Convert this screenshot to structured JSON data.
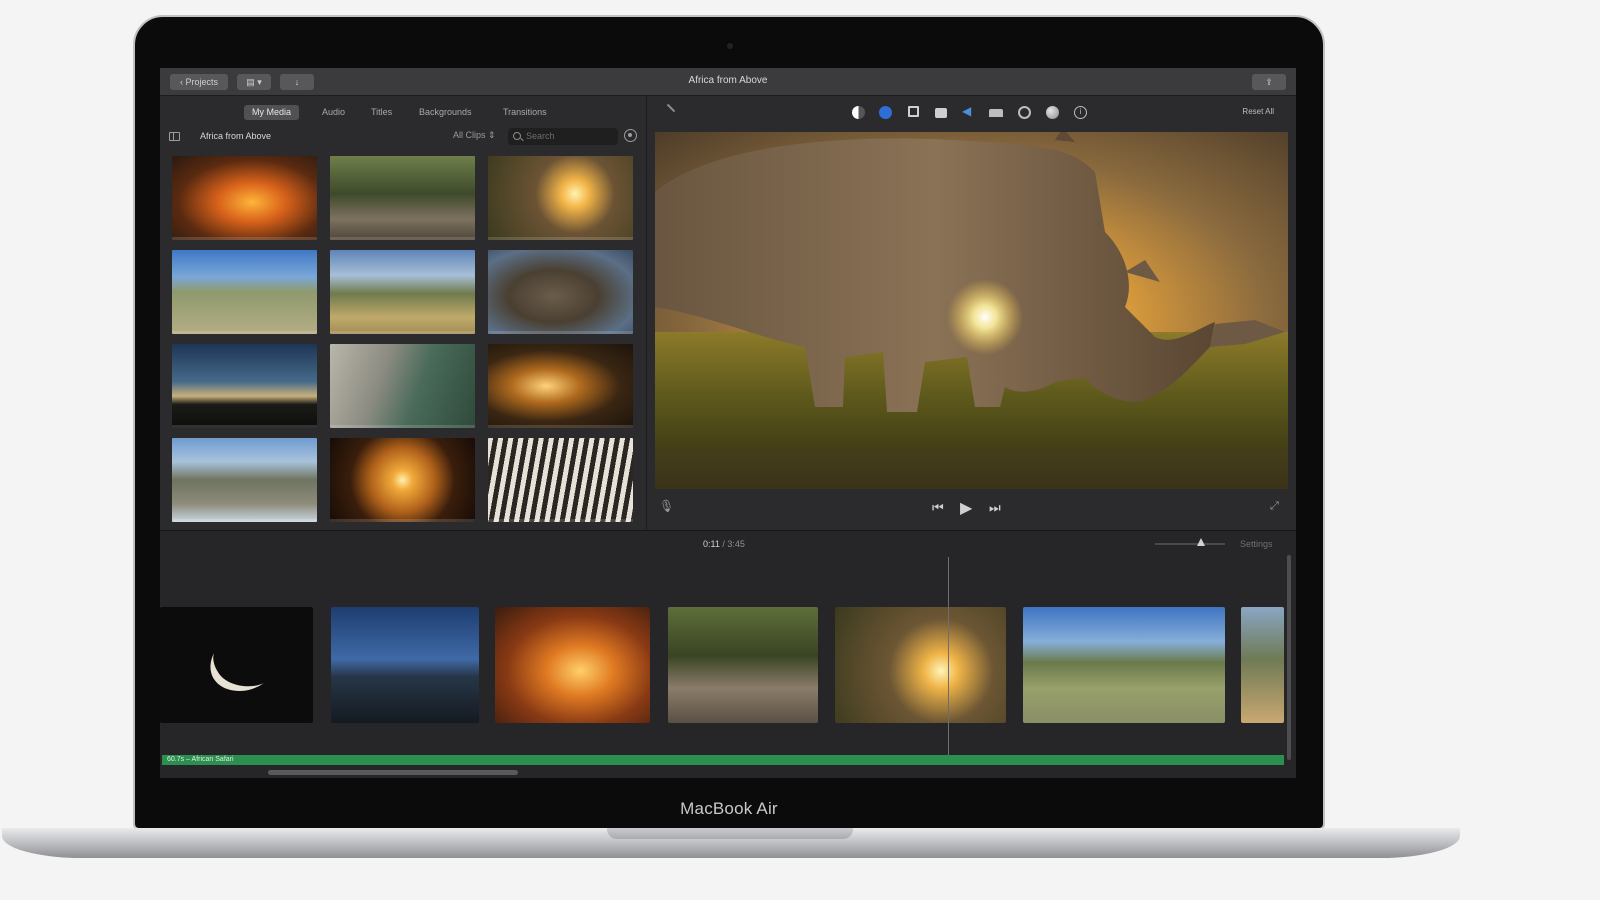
{
  "device": {
    "brand_label": "MacBook Air"
  },
  "window": {
    "title": "Africa from Above",
    "projects_button": "Projects"
  },
  "media_tabs": [
    "My Media",
    "Audio",
    "Titles",
    "Backgrounds",
    "Transitions"
  ],
  "library": {
    "title": "Africa from Above",
    "filter": "All Clips",
    "search_placeholder": "Search"
  },
  "thumbnails": [
    "fire-clip",
    "forest-clip",
    "rhino-sunset-clip",
    "zebras-clip",
    "savanna-clip",
    "rhino-clip",
    "silhouette-clip",
    "hands-clip",
    "sunlight-clip",
    "herd-clip",
    "sunset-clip",
    "zebra-clip"
  ],
  "viewer_toolbar": {
    "icons": [
      "color-balance-icon",
      "color-correction-icon",
      "crop-icon",
      "stabilization-icon",
      "volume-icon",
      "noise-reduction-icon",
      "speed-icon",
      "clip-filter-icon",
      "info-icon"
    ],
    "reset_label": "Reset All"
  },
  "timeline": {
    "current_time": "0:11",
    "total_time": "/ 3:45",
    "settings_label": "Settings",
    "audio_label": "60.7s – African Safari"
  },
  "colors": {
    "audio_track": "#2c8f4f",
    "accent_blue": "#2d6fd4"
  }
}
